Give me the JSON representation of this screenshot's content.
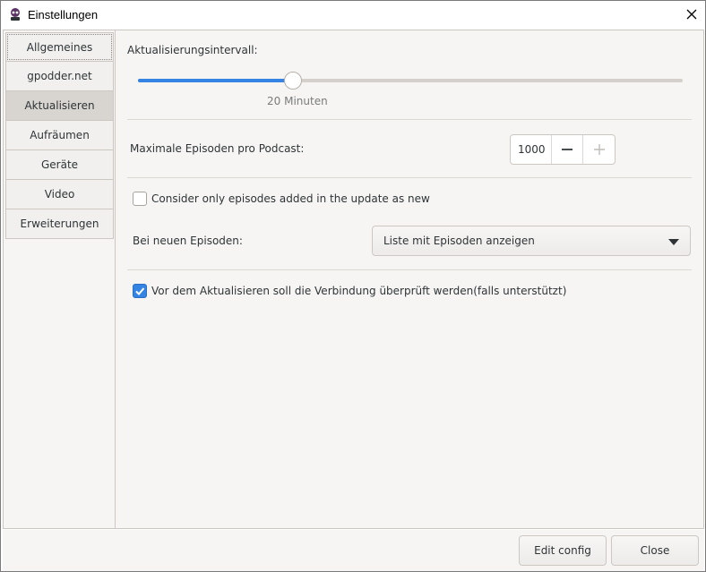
{
  "window": {
    "title": "Einstellungen"
  },
  "sidebar": {
    "items": [
      {
        "label": "Allgemeines"
      },
      {
        "label": "gpodder.net"
      },
      {
        "label": "Aktualisieren"
      },
      {
        "label": "Aufräumen"
      },
      {
        "label": "Geräte"
      },
      {
        "label": "Video"
      },
      {
        "label": "Erweiterungen"
      }
    ],
    "active_index": 2
  },
  "update": {
    "interval_label": "Aktualisierungsintervall:",
    "interval_value_text": "20 Minuten",
    "slider_fraction": 0.285,
    "max_episodes_label": "Maximale Episoden pro Podcast:",
    "max_episodes_value": "1000",
    "consider_only_label": "Consider only episodes added in the update as new",
    "consider_only_checked": false,
    "new_episodes_label": "Bei neuen Episoden:",
    "new_episodes_option": "Liste mit Episoden anzeigen",
    "check_connection_label": "Vor dem Aktualisieren soll die  Verbindung  überprüft werden(falls unterstützt)",
    "check_connection_checked": true
  },
  "footer": {
    "edit_config_label": "Edit config",
    "close_label": "Close"
  },
  "colors": {
    "accent": "#3584e4",
    "background": "#f6f5f4",
    "active_tab": "#d8d4d0"
  }
}
